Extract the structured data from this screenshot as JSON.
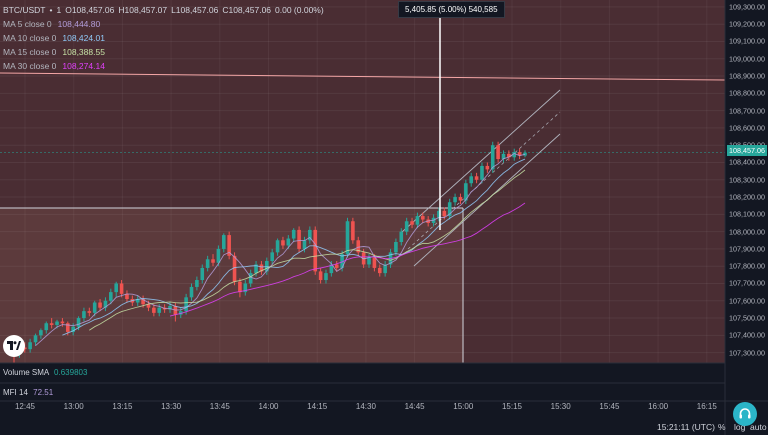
{
  "symbol": {
    "title": "BTC/USDT",
    "interval": "1",
    "open": "O108,457.06",
    "high": "H108,457.07",
    "low": "L108,457.06",
    "close": "C108,457.06",
    "change": "0.00 (0.00%)"
  },
  "ma_legend": [
    {
      "label": "MA 5 close 0",
      "value": "108,444.80",
      "color": "#b39ddb"
    },
    {
      "label": "MA 10 close 0",
      "value": "108,424.01",
      "color": "#90caf9"
    },
    {
      "label": "MA 15 close 0",
      "value": "108,388.55",
      "color": "#c5e1a5"
    },
    {
      "label": "MA 30 close 0",
      "value": "108,274.14",
      "color": "#e040fb"
    }
  ],
  "measure": {
    "text": "5,405.85 (5.00%) 540,585"
  },
  "last_price": {
    "label": "108,457.06",
    "value": 108457.06
  },
  "horizontal_line_price": 108900,
  "price_axis": {
    "ticks": [
      "109,300.00",
      "109,200.00",
      "109,100.00",
      "109,000.00",
      "108,900.00",
      "108,800.00",
      "108,700.00",
      "108,600.00",
      "108,500.00",
      "108,400.00",
      "108,300.00",
      "108,200.00",
      "108,100.00",
      "108,000.00",
      "107,900.00",
      "107,800.00",
      "107,700.00",
      "107,600.00",
      "107,500.00",
      "107,400.00",
      "107,300.00"
    ],
    "tick_values": [
      109300,
      109200,
      109100,
      109000,
      108900,
      108800,
      108700,
      108600,
      108500,
      108400,
      108300,
      108200,
      108100,
      108000,
      107900,
      107800,
      107700,
      107600,
      107500,
      107400,
      107300
    ]
  },
  "time_axis": {
    "ticks": [
      "12:45",
      "13:00",
      "13:15",
      "13:30",
      "13:45",
      "14:00",
      "14:15",
      "14:30",
      "14:45",
      "15:00",
      "15:15",
      "15:30",
      "15:45",
      "16:00",
      "16:15"
    ]
  },
  "volume": {
    "label": "Volume SMA",
    "value": "0.639803"
  },
  "mfi": {
    "label": "MFI 14",
    "value": "72.51"
  },
  "bottom": {
    "clock": "15:21:11 (UTC)",
    "percent": "%",
    "log": "log",
    "auto": "auto"
  },
  "colors": {
    "up": "#26a69a",
    "down": "#ef5350",
    "bg_upper": "#4a2d33",
    "bg_lower": "#5c3a3c",
    "hline": "#f4a6a6",
    "crosshair": "#ffffff"
  },
  "chart_data": {
    "type": "candlestick",
    "symbol": "BTC/USDT",
    "interval": "1",
    "y_range": [
      107240,
      109340
    ],
    "candles": [
      [
        107300,
        107290,
        107320,
        107240
      ],
      [
        107290,
        107330,
        107350,
        107270
      ],
      [
        107330,
        107320,
        107360,
        107300
      ],
      [
        107320,
        107360,
        107380,
        107300
      ],
      [
        107360,
        107400,
        107410,
        107340
      ],
      [
        107400,
        107430,
        107440,
        107380
      ],
      [
        107430,
        107470,
        107480,
        107410
      ],
      [
        107470,
        107460,
        107500,
        107440
      ],
      [
        107460,
        107480,
        107490,
        107440
      ],
      [
        107480,
        107470,
        107500,
        107450
      ],
      [
        107470,
        107420,
        107480,
        107400
      ],
      [
        107420,
        107450,
        107470,
        107400
      ],
      [
        107450,
        107500,
        107510,
        107430
      ],
      [
        107500,
        107540,
        107560,
        107480
      ],
      [
        107540,
        107530,
        107560,
        107510
      ],
      [
        107530,
        107590,
        107600,
        107510
      ],
      [
        107590,
        107560,
        107610,
        107540
      ],
      [
        107560,
        107600,
        107620,
        107540
      ],
      [
        107600,
        107650,
        107670,
        107580
      ],
      [
        107650,
        107700,
        107710,
        107620
      ],
      [
        107700,
        107640,
        107720,
        107620
      ],
      [
        107640,
        107610,
        107660,
        107590
      ],
      [
        107610,
        107590,
        107630,
        107570
      ],
      [
        107590,
        107610,
        107630,
        107570
      ],
      [
        107610,
        107580,
        107630,
        107560
      ],
      [
        107580,
        107560,
        107600,
        107540
      ],
      [
        107560,
        107530,
        107580,
        107510
      ],
      [
        107530,
        107560,
        107580,
        107510
      ],
      [
        107560,
        107550,
        107580,
        107530
      ],
      [
        107550,
        107570,
        107590,
        107530
      ],
      [
        107570,
        107520,
        107590,
        107480
      ],
      [
        107520,
        107540,
        107560,
        107500
      ],
      [
        107540,
        107620,
        107640,
        107520
      ],
      [
        107620,
        107680,
        107700,
        107600
      ],
      [
        107680,
        107720,
        107740,
        107660
      ],
      [
        107720,
        107790,
        107810,
        107700
      ],
      [
        107790,
        107840,
        107860,
        107770
      ],
      [
        107840,
        107820,
        107870,
        107800
      ],
      [
        107820,
        107900,
        107920,
        107800
      ],
      [
        107900,
        107980,
        107990,
        107880
      ],
      [
        107980,
        107860,
        108000,
        107840
      ],
      [
        107860,
        107710,
        107880,
        107690
      ],
      [
        107710,
        107650,
        107730,
        107620
      ],
      [
        107650,
        107700,
        107720,
        107630
      ],
      [
        107700,
        107760,
        107780,
        107680
      ],
      [
        107760,
        107810,
        107830,
        107740
      ],
      [
        107810,
        107770,
        107830,
        107750
      ],
      [
        107770,
        107830,
        107850,
        107750
      ],
      [
        107830,
        107880,
        107900,
        107810
      ],
      [
        107880,
        107950,
        107960,
        107860
      ],
      [
        107950,
        107920,
        107970,
        107900
      ],
      [
        107920,
        107960,
        107980,
        107900
      ],
      [
        107960,
        108010,
        108020,
        107940
      ],
      [
        108010,
        107900,
        108030,
        107880
      ],
      [
        107900,
        107950,
        107970,
        107880
      ],
      [
        107950,
        108010,
        108030,
        107930
      ],
      [
        108010,
        107770,
        108030,
        107750
      ],
      [
        107770,
        107720,
        107790,
        107700
      ],
      [
        107720,
        107760,
        107780,
        107700
      ],
      [
        107760,
        107810,
        107830,
        107740
      ],
      [
        107810,
        107790,
        107830,
        107770
      ],
      [
        107790,
        107870,
        107890,
        107770
      ],
      [
        107870,
        108060,
        108080,
        107850
      ],
      [
        108060,
        107950,
        108080,
        107930
      ],
      [
        107950,
        107880,
        107970,
        107860
      ],
      [
        107880,
        107810,
        107900,
        107790
      ],
      [
        107810,
        107850,
        107870,
        107790
      ],
      [
        107850,
        107790,
        107870,
        107770
      ],
      [
        107790,
        107760,
        107810,
        107740
      ],
      [
        107760,
        107810,
        107830,
        107740
      ],
      [
        107810,
        107880,
        107900,
        107790
      ],
      [
        107880,
        107940,
        107960,
        107860
      ],
      [
        107940,
        108000,
        108020,
        107920
      ],
      [
        108000,
        108060,
        108080,
        107980
      ],
      [
        108060,
        108040,
        108080,
        108020
      ],
      [
        108040,
        108090,
        108110,
        108020
      ],
      [
        108090,
        108070,
        108110,
        108050
      ],
      [
        108070,
        108050,
        108090,
        108030
      ],
      [
        108050,
        108080,
        108100,
        108030
      ],
      [
        108080,
        108120,
        108140,
        108060
      ],
      [
        108120,
        108090,
        108140,
        108070
      ],
      [
        108090,
        108170,
        108190,
        108070
      ],
      [
        108170,
        108200,
        108220,
        108150
      ],
      [
        108200,
        108180,
        108220,
        108160
      ],
      [
        108180,
        108280,
        108300,
        108160
      ],
      [
        108280,
        108320,
        108340,
        108260
      ],
      [
        108320,
        108300,
        108340,
        108280
      ],
      [
        108300,
        108380,
        108400,
        108280
      ],
      [
        108380,
        108360,
        108400,
        108340
      ],
      [
        108360,
        108500,
        108520,
        108340
      ],
      [
        108500,
        108420,
        108520,
        108400
      ],
      [
        108420,
        108450,
        108470,
        108400
      ],
      [
        108450,
        108430,
        108470,
        108410
      ],
      [
        108430,
        108460,
        108480,
        108410
      ],
      [
        108460,
        108440,
        108480,
        108420
      ],
      [
        108440,
        108457,
        108470,
        108430
      ]
    ]
  }
}
